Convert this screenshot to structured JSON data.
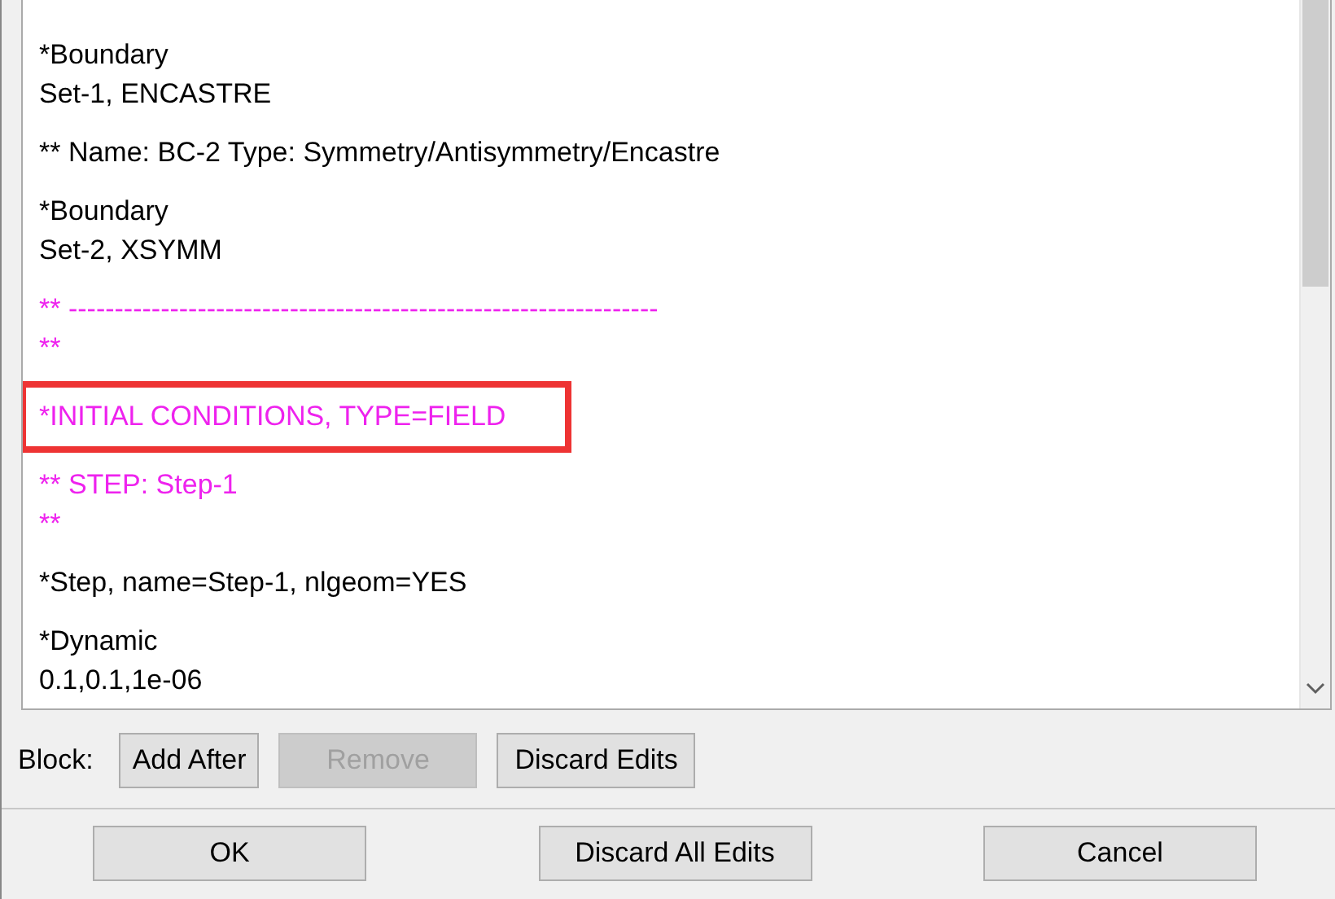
{
  "editor": {
    "blocks": [
      {
        "kind": "keyword",
        "highlighted": false,
        "lines": [
          "*Boundary",
          "Set-1, ENCASTRE"
        ]
      },
      {
        "kind": "comment_plain",
        "highlighted": false,
        "lines": [
          "** Name: BC-2 Type: Symmetry/Antisymmetry/Encastre"
        ]
      },
      {
        "kind": "keyword",
        "highlighted": false,
        "lines": [
          "*Boundary",
          "Set-2, XSYMM"
        ]
      },
      {
        "kind": "comment",
        "highlighted": false,
        "lines": [
          "** ----------------------------------------------------------------",
          "**"
        ]
      },
      {
        "kind": "comment",
        "highlighted": true,
        "lines": [
          "*INITIAL CONDITIONS, TYPE=FIELD"
        ]
      },
      {
        "kind": "comment",
        "highlighted": false,
        "lines": [
          "** STEP: Step-1",
          "**"
        ]
      },
      {
        "kind": "keyword",
        "highlighted": false,
        "lines": [
          "*Step, name=Step-1, nlgeom=YES"
        ]
      },
      {
        "kind": "keyword",
        "highlighted": false,
        "lines": [
          "*Dynamic",
          "0.1,0.1,1e-06"
        ]
      }
    ]
  },
  "block_bar": {
    "label": "Block:",
    "buttons": [
      {
        "label": "Add After",
        "disabled": false
      },
      {
        "label": "Remove",
        "disabled": true
      },
      {
        "label": "Discard Edits",
        "disabled": false
      }
    ]
  },
  "dialog_buttons": [
    "OK",
    "Discard All Edits",
    "Cancel"
  ]
}
